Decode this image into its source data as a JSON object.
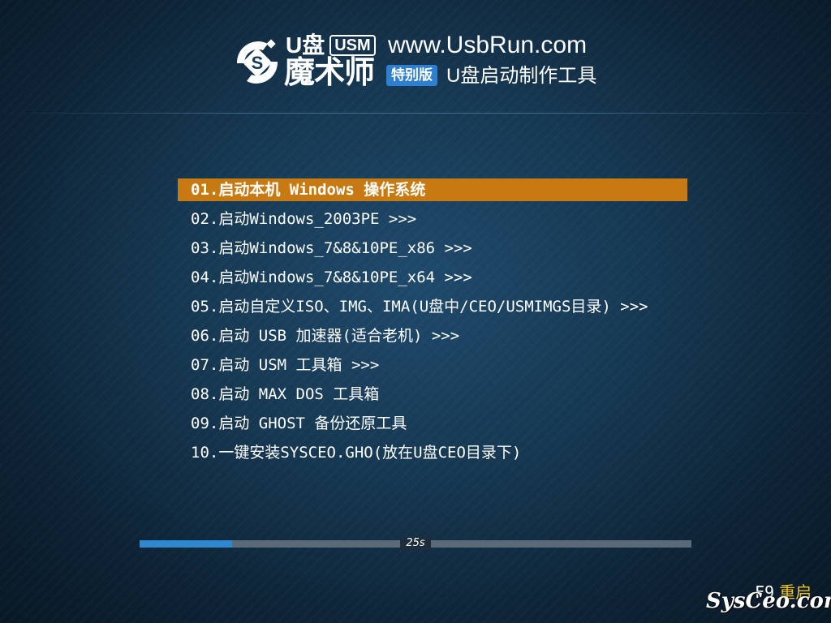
{
  "header": {
    "logo_u": "U盘",
    "logo_usm": "USM",
    "logo_name": "魔术师",
    "site_url": "www.UsbRun.com",
    "edition_badge": "特别版",
    "subtitle": "U盘启动制作工具"
  },
  "menu": {
    "selected_index": 0,
    "items": [
      {
        "label": "01.启动本机 Windows 操作系统"
      },
      {
        "label": "02.启动Windows_2003PE >>>"
      },
      {
        "label": "03.启动Windows_7&8&10PE_x86 >>>"
      },
      {
        "label": "04.启动Windows_7&8&10PE_x64 >>>"
      },
      {
        "label": "05.启动自定义ISO、IMG、IMA(U盘中/CEO/USMIMGS目录) >>>"
      },
      {
        "label": "06.启动 USB 加速器(适合老机) >>>"
      },
      {
        "label": "07.启动 USM 工具箱 >>>"
      },
      {
        "label": "08.启动 MAX DOS 工具箱"
      },
      {
        "label": "09.启动 GHOST 备份还原工具"
      },
      {
        "label": "10.一键安装SYSCEO.GHO(放在U盘CEO目录下)"
      }
    ]
  },
  "progress": {
    "fraction": 0.168,
    "countdown": "25s"
  },
  "footer": {
    "reboot_key": "F9",
    "reboot_label": "重启",
    "watermark": "SysCeo.com"
  },
  "colors": {
    "selected_bg": "#c87a12",
    "progress_fill": "#2f88cf",
    "reboot_label": "#f0c419",
    "badge_bg": "#2f7fd0"
  }
}
